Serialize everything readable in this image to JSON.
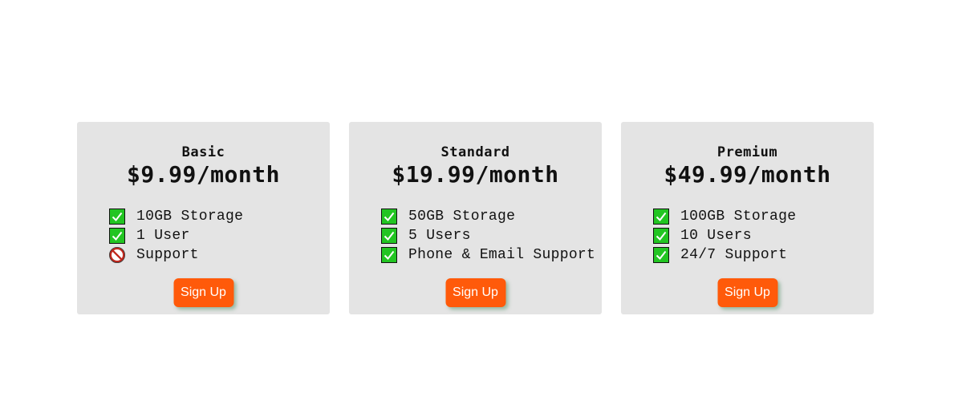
{
  "colors": {
    "card_background": "#e4e4e4",
    "button_background": "#ff5a0a",
    "check_green": "#22c522",
    "prohibited_red": "#c0281e"
  },
  "plans": [
    {
      "name": "Basic",
      "price": "$9.99/month",
      "features": [
        {
          "label": "10GB Storage",
          "icon": "check-icon"
        },
        {
          "label": "1 User",
          "icon": "check-icon"
        },
        {
          "label": "Support",
          "icon": "prohibited-icon"
        }
      ],
      "button_label": "Sign Up"
    },
    {
      "name": "Standard",
      "price": "$19.99/month",
      "features": [
        {
          "label": "50GB Storage",
          "icon": "check-icon"
        },
        {
          "label": "5 Users",
          "icon": "check-icon"
        },
        {
          "label": "Phone & Email Support",
          "icon": "check-icon"
        }
      ],
      "button_label": "Sign Up"
    },
    {
      "name": "Premium",
      "price": "$49.99/month",
      "features": [
        {
          "label": "100GB Storage",
          "icon": "check-icon"
        },
        {
          "label": "10 Users",
          "icon": "check-icon"
        },
        {
          "label": "24/7 Support",
          "icon": "check-icon"
        }
      ],
      "button_label": "Sign Up"
    }
  ]
}
